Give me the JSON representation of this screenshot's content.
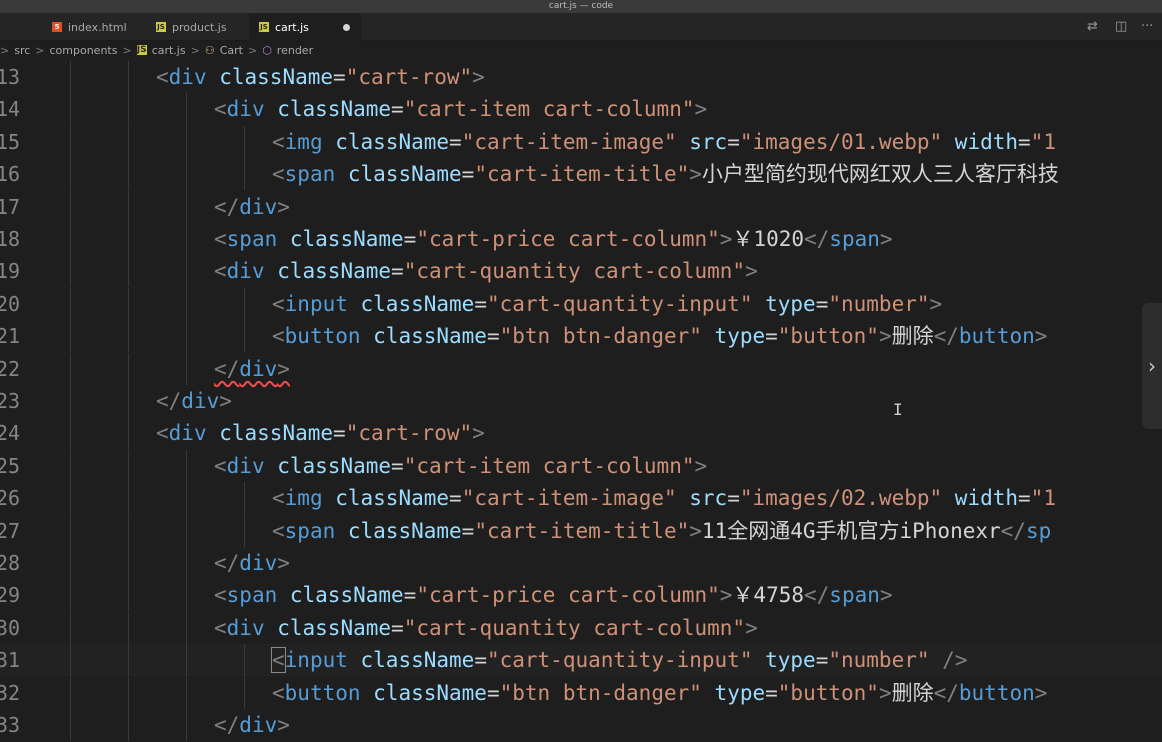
{
  "window": {
    "title": "cart.js — code"
  },
  "tabs": [
    {
      "label": "index.html",
      "icon": "html-file-icon"
    },
    {
      "label": "product.js",
      "icon": "js-file-icon"
    },
    {
      "label": "cart.js",
      "icon": "js-file-icon",
      "active": true,
      "modified": true
    }
  ],
  "toolbar": {
    "compare_icon": "⇄",
    "split_icon": "◫",
    "more_icon": "···"
  },
  "breadcrumb": [
    "src",
    "components",
    "cart.js",
    "Cart",
    "render"
  ],
  "breadcrumb_sep": ">",
  "editor": {
    "lines": [
      {
        "n": "13",
        "indent": 1,
        "tokens": [
          [
            "<",
            "p"
          ],
          [
            "div",
            "t"
          ],
          [
            " className",
            "a"
          ],
          [
            "=",
            "e"
          ],
          [
            "\"cart-row\"",
            "s"
          ],
          [
            ">",
            "p"
          ]
        ]
      },
      {
        "n": "14",
        "indent": 2,
        "tokens": [
          [
            "<",
            "p"
          ],
          [
            "div",
            "t"
          ],
          [
            " className",
            "a"
          ],
          [
            "=",
            "e"
          ],
          [
            "\"cart-item cart-column\"",
            "s"
          ],
          [
            ">",
            "p"
          ]
        ]
      },
      {
        "n": "15",
        "indent": 3,
        "tokens": [
          [
            "<",
            "p"
          ],
          [
            "img",
            "t"
          ],
          [
            " className",
            "a"
          ],
          [
            "=",
            "e"
          ],
          [
            "\"cart-item-image\"",
            "s"
          ],
          [
            " src",
            "a"
          ],
          [
            "=",
            "e"
          ],
          [
            "\"images/01.webp\"",
            "s"
          ],
          [
            " width",
            "a"
          ],
          [
            "=",
            "e"
          ],
          [
            "\"1",
            "s"
          ]
        ]
      },
      {
        "n": "16",
        "indent": 3,
        "tokens": [
          [
            "<",
            "p"
          ],
          [
            "span",
            "t"
          ],
          [
            " className",
            "a"
          ],
          [
            "=",
            "e"
          ],
          [
            "\"cart-item-title\"",
            "s"
          ],
          [
            ">",
            "p"
          ],
          [
            "小户型简约现代网红双人三人客厅科技",
            "x"
          ]
        ]
      },
      {
        "n": "17",
        "indent": 2,
        "tokens": [
          [
            "</",
            "p"
          ],
          [
            "div",
            "t"
          ],
          [
            ">",
            "p"
          ]
        ]
      },
      {
        "n": "18",
        "indent": 2,
        "tokens": [
          [
            "<",
            "p"
          ],
          [
            "span",
            "t"
          ],
          [
            " className",
            "a"
          ],
          [
            "=",
            "e"
          ],
          [
            "\"cart-price cart-column\"",
            "s"
          ],
          [
            ">",
            "p"
          ],
          [
            "￥1020",
            "x"
          ],
          [
            "</",
            "p"
          ],
          [
            "span",
            "t"
          ],
          [
            ">",
            "p"
          ]
        ]
      },
      {
        "n": "19",
        "indent": 2,
        "tokens": [
          [
            "<",
            "p"
          ],
          [
            "div",
            "t"
          ],
          [
            " className",
            "a"
          ],
          [
            "=",
            "e"
          ],
          [
            "\"cart-quantity cart-column\"",
            "s"
          ],
          [
            ">",
            "p"
          ]
        ]
      },
      {
        "n": "20",
        "indent": 3,
        "tokens": [
          [
            "<",
            "p"
          ],
          [
            "input",
            "t"
          ],
          [
            " className",
            "a"
          ],
          [
            "=",
            "e"
          ],
          [
            "\"cart-quantity-input\"",
            "s"
          ],
          [
            " type",
            "a"
          ],
          [
            "=",
            "e"
          ],
          [
            "\"number\"",
            "s"
          ],
          [
            ">",
            "p"
          ]
        ]
      },
      {
        "n": "21",
        "indent": 3,
        "tokens": [
          [
            "<",
            "p"
          ],
          [
            "button",
            "t"
          ],
          [
            " className",
            "a"
          ],
          [
            "=",
            "e"
          ],
          [
            "\"btn btn-danger\"",
            "s"
          ],
          [
            " type",
            "a"
          ],
          [
            "=",
            "e"
          ],
          [
            "\"button\"",
            "s"
          ],
          [
            ">",
            "p"
          ],
          [
            "删除",
            "x"
          ],
          [
            "</",
            "p"
          ],
          [
            "button",
            "t"
          ],
          [
            ">",
            "p"
          ]
        ]
      },
      {
        "n": "22",
        "indent": 2,
        "squiggle": true,
        "tokens": [
          [
            "</",
            "p"
          ],
          [
            "div",
            "t"
          ],
          [
            ">",
            "p"
          ]
        ]
      },
      {
        "n": "23",
        "indent": 1,
        "tokens": [
          [
            "</",
            "p"
          ],
          [
            "div",
            "t"
          ],
          [
            ">",
            "p"
          ]
        ]
      },
      {
        "n": "24",
        "indent": 1,
        "tokens": [
          [
            "<",
            "p"
          ],
          [
            "div",
            "t"
          ],
          [
            " className",
            "a"
          ],
          [
            "=",
            "e"
          ],
          [
            "\"cart-row\"",
            "s"
          ],
          [
            ">",
            "p"
          ]
        ]
      },
      {
        "n": "25",
        "indent": 2,
        "tokens": [
          [
            "<",
            "p"
          ],
          [
            "div",
            "t"
          ],
          [
            " className",
            "a"
          ],
          [
            "=",
            "e"
          ],
          [
            "\"cart-item cart-column\"",
            "s"
          ],
          [
            ">",
            "p"
          ]
        ]
      },
      {
        "n": "26",
        "indent": 3,
        "tokens": [
          [
            "<",
            "p"
          ],
          [
            "img",
            "t"
          ],
          [
            " className",
            "a"
          ],
          [
            "=",
            "e"
          ],
          [
            "\"cart-item-image\"",
            "s"
          ],
          [
            " src",
            "a"
          ],
          [
            "=",
            "e"
          ],
          [
            "\"images/02.webp\"",
            "s"
          ],
          [
            " width",
            "a"
          ],
          [
            "=",
            "e"
          ],
          [
            "\"1",
            "s"
          ]
        ]
      },
      {
        "n": "27",
        "indent": 3,
        "tokens": [
          [
            "<",
            "p"
          ],
          [
            "span",
            "t"
          ],
          [
            " className",
            "a"
          ],
          [
            "=",
            "e"
          ],
          [
            "\"cart-item-title\"",
            "s"
          ],
          [
            ">",
            "p"
          ],
          [
            "11全网通4G手机官方iPhonexr",
            "x"
          ],
          [
            "</",
            "p"
          ],
          [
            "sp",
            "t"
          ]
        ]
      },
      {
        "n": "28",
        "indent": 2,
        "tokens": [
          [
            "</",
            "p"
          ],
          [
            "div",
            "t"
          ],
          [
            ">",
            "p"
          ]
        ]
      },
      {
        "n": "29",
        "indent": 2,
        "tokens": [
          [
            "<",
            "p"
          ],
          [
            "span",
            "t"
          ],
          [
            " className",
            "a"
          ],
          [
            "=",
            "e"
          ],
          [
            "\"cart-price cart-column\"",
            "s"
          ],
          [
            ">",
            "p"
          ],
          [
            "￥4758",
            "x"
          ],
          [
            "</",
            "p"
          ],
          [
            "span",
            "t"
          ],
          [
            ">",
            "p"
          ]
        ]
      },
      {
        "n": "30",
        "indent": 2,
        "tokens": [
          [
            "<",
            "p"
          ],
          [
            "div",
            "t"
          ],
          [
            " className",
            "a"
          ],
          [
            "=",
            "e"
          ],
          [
            "\"cart-quantity cart-column\"",
            "s"
          ],
          [
            ">",
            "p"
          ]
        ]
      },
      {
        "n": "31",
        "indent": 3,
        "cursor": true,
        "tokens": [
          [
            "<",
            "p"
          ],
          [
            "input",
            "t"
          ],
          [
            " className",
            "a"
          ],
          [
            "=",
            "e"
          ],
          [
            "\"cart-quantity-input\"",
            "s"
          ],
          [
            " type",
            "a"
          ],
          [
            "=",
            "e"
          ],
          [
            "\"number\"",
            "s"
          ],
          [
            " /",
            "p"
          ],
          [
            ">",
            "p"
          ]
        ]
      },
      {
        "n": "32",
        "indent": 3,
        "tokens": [
          [
            "<",
            "p"
          ],
          [
            "button",
            "t"
          ],
          [
            " className",
            "a"
          ],
          [
            "=",
            "e"
          ],
          [
            "\"btn btn-danger\"",
            "s"
          ],
          [
            " type",
            "a"
          ],
          [
            "=",
            "e"
          ],
          [
            "\"button\"",
            "s"
          ],
          [
            ">",
            "p"
          ],
          [
            "删除",
            "x"
          ],
          [
            "</",
            "p"
          ],
          [
            "button",
            "t"
          ],
          [
            ">",
            "p"
          ]
        ]
      },
      {
        "n": "33",
        "indent": 2,
        "tokens": [
          [
            "</",
            "p"
          ],
          [
            "div",
            "t"
          ],
          [
            ">",
            "p"
          ]
        ]
      }
    ]
  },
  "overlay": {
    "scroll_arrow": "›",
    "mouse_cursor": "I"
  }
}
